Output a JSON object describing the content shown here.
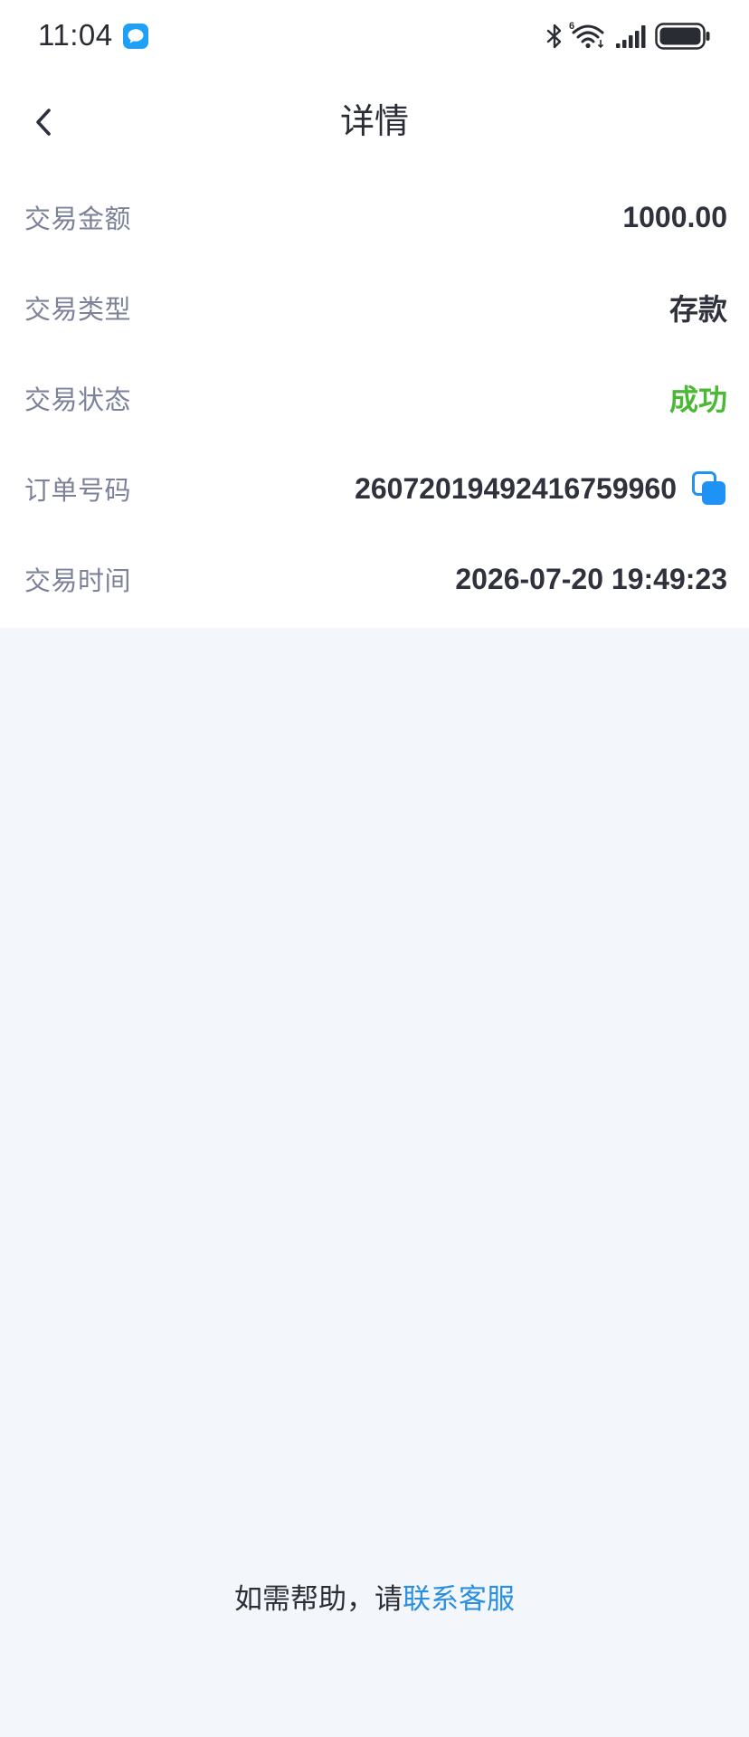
{
  "status_bar": {
    "time": "11:04",
    "notification_icon": "chat-bubble-icon",
    "wifi_badge": "6",
    "icons": [
      "bluetooth-icon",
      "wifi-6-icon",
      "signal-icon",
      "battery-icon"
    ],
    "signal_level": 1,
    "battery_level": 1
  },
  "header": {
    "back_icon": "chevron-left-icon",
    "title": "详情"
  },
  "details": [
    {
      "label": "交易金额",
      "value": "1000.00"
    },
    {
      "label": "交易类型",
      "value": "存款"
    },
    {
      "label": "交易状态",
      "value": "成功",
      "value_color": "#4bb935"
    },
    {
      "label": "订单号码",
      "value": "26072019492416759960",
      "action_icon": "copy-icon"
    },
    {
      "label": "交易时间",
      "value": "2026-07-20 19:49:23"
    }
  ],
  "footer": {
    "prefix": "如需帮助，请",
    "link": "联系客服"
  },
  "colors": {
    "page_background": "#f3f7fc",
    "card_background": "#ffffff",
    "label": "#7b8299",
    "value": "#2f323c",
    "success": "#4bb935",
    "link": "#2a8fe0",
    "accent": "#1f93f5"
  }
}
